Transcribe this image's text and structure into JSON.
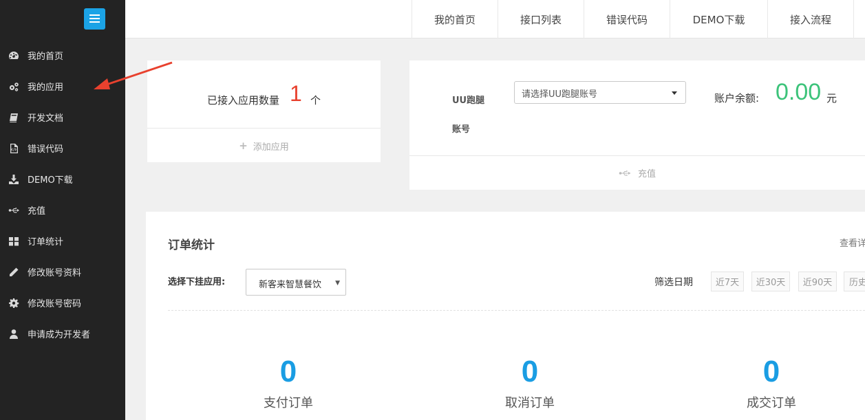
{
  "sidebar": {
    "items": [
      {
        "label": "我的首页",
        "icon": "dashboard-icon"
      },
      {
        "label": "我的应用",
        "icon": "gears-icon"
      },
      {
        "label": "开发文档",
        "icon": "book-icon"
      },
      {
        "label": "错误代码",
        "icon": "code-file-icon"
      },
      {
        "label": "DEMO下载",
        "icon": "download-icon"
      },
      {
        "label": "充值",
        "icon": "usb-icon"
      },
      {
        "label": "订单统计",
        "icon": "grid-icon"
      },
      {
        "label": "修改账号资料",
        "icon": "pencil-icon"
      },
      {
        "label": "修改账号密码",
        "icon": "gear-icon"
      },
      {
        "label": "申请成为开发者",
        "icon": "user-icon"
      }
    ]
  },
  "topbar": {
    "tabs": [
      "我的首页",
      "接口列表",
      "错误代码",
      "DEMO下载",
      "接入流程"
    ]
  },
  "app_count": {
    "label": "已接入应用数量",
    "value": "1",
    "unit": "个",
    "add_label": "添加应用"
  },
  "balance": {
    "uu_label_line1": "UU跑腿",
    "uu_label_line2": "账号",
    "uu_placeholder": "请选择UU跑腿账号",
    "label": "账户余额:",
    "value": "0.00",
    "unit": "元",
    "recharge_label": "充值"
  },
  "orders": {
    "title": "订单统计",
    "view_detail": "查看详",
    "select_app_label": "选择下挂应用:",
    "selected_app": "新客来智慧餐饮",
    "filter_date_label": "筛选日期",
    "date_ranges": [
      "近7天",
      "近30天",
      "近90天",
      "历史"
    ],
    "stats": [
      {
        "value": "0",
        "label": "支付订单"
      },
      {
        "value": "0",
        "label": "取消订单"
      },
      {
        "value": "0",
        "label": "成交订单"
      }
    ]
  },
  "colors": {
    "sidebar_bg": "#232323",
    "accent_blue": "#1ba3e6",
    "count_red": "#e8412e",
    "balance_green": "#3cc37a",
    "stat_blue": "#1a9de3",
    "annotation_arrow": "#e8412e"
  }
}
